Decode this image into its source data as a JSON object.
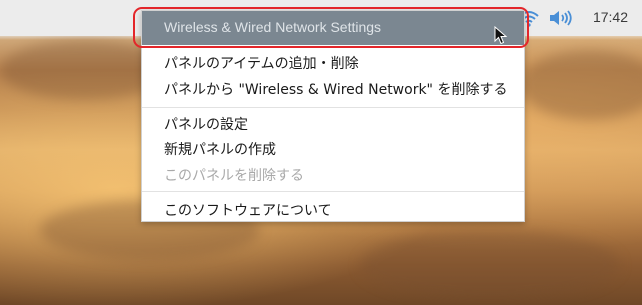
{
  "panel": {
    "clock": "17:42",
    "tray_icons": [
      "bluetooth-icon",
      "wifi-icon",
      "volume-icon"
    ]
  },
  "menu": {
    "header": "Wireless & Wired Network Settings",
    "items": [
      "パネルのアイテムの追加・削除",
      "パネルから \"Wireless & Wired Network\" を削除する",
      "パネルの設定",
      "新規パネルの作成",
      "このパネルを削除する",
      "このソフトウェアについて"
    ]
  },
  "colors": {
    "highlight": "#e3262a",
    "header_bg": "#7b8791",
    "disabled_text": "#a9a9a9"
  }
}
